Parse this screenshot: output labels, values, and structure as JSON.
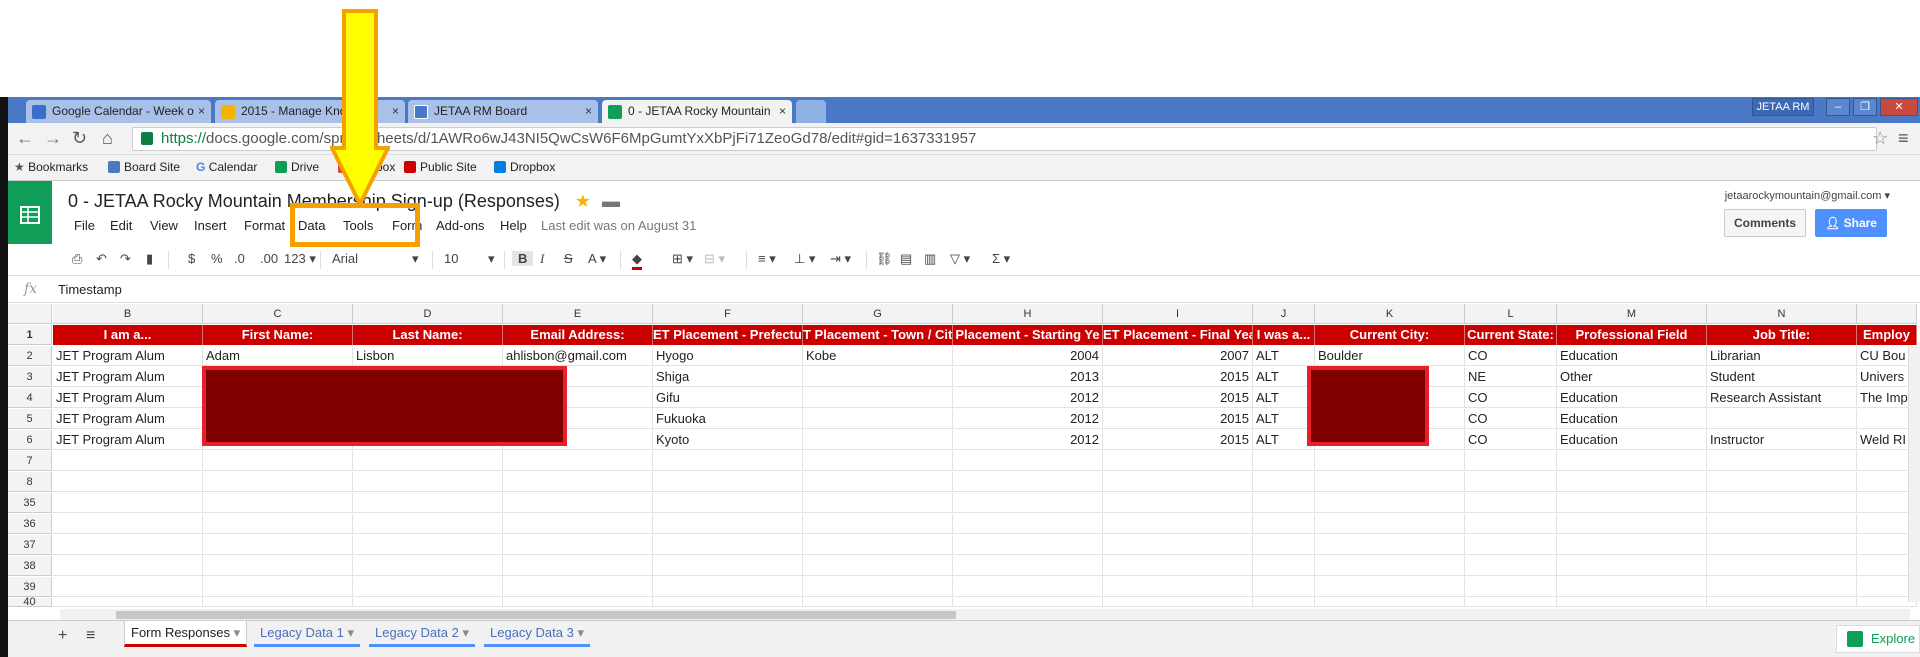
{
  "browser": {
    "tabs": [
      {
        "title": "Google Calendar - Week o",
        "icon_color": "#3b6fc7"
      },
      {
        "title": "2015 - Manage Kno",
        "icon_color": "#f4b400"
      },
      {
        "title": "JETAA RM Board",
        "icon_color": "#4a78c4"
      },
      {
        "title": "0 - JETAA Rocky Mountain",
        "icon_color": "#0f9d58"
      }
    ],
    "tab_close": "×",
    "profile_label": "JETAA RM",
    "window_buttons": [
      "–",
      "❐",
      "✕"
    ],
    "url_scheme": "https://",
    "url_rest": "docs.google.com/spreadsheets/d/1AWRo6wJ43NI5QwCsW6F6MpGumtYxXbPjFi71ZeoGd78/edit#gid=1637331957",
    "bookmarks": [
      {
        "label": "Bookmarks",
        "icon": "star-icon",
        "color": "#555555"
      },
      {
        "label": "Board Site",
        "icon": "board-icon",
        "color": "#4a78c4"
      },
      {
        "label": "Calendar",
        "icon": "google-icon",
        "color": "#4285f4"
      },
      {
        "label": "Drive",
        "icon": "drive-icon",
        "color": "#0f9d58"
      },
      {
        "label": "Mailbox",
        "icon": "mail-icon",
        "color": "#db4437"
      },
      {
        "label": "Public Site",
        "icon": "site-icon",
        "color": "#cc0000"
      },
      {
        "label": "Dropbox",
        "icon": "dropbox-icon",
        "color": "#007ee5"
      }
    ]
  },
  "sheets": {
    "doc_title": "0 - JETAA Rocky Mountain Membership Sign-up (Responses)",
    "menu": [
      "File",
      "Edit",
      "View",
      "Insert",
      "Format",
      "Data",
      "Tools",
      "Form",
      "Add-ons",
      "Help"
    ],
    "last_edit": "Last edit was on August 31",
    "account": "jetaarockymountain@gmail.com",
    "comments_label": "Comments",
    "share_label": "Share",
    "toolbar": {
      "currency": "$",
      "percent": "%",
      "dec_less": ".0",
      "dec_more": ".00",
      "more_formats": "123",
      "font": "Arial",
      "size": "10",
      "bold": "B",
      "italic": "I",
      "strike": "S",
      "text_color": "A",
      "sigma": "Σ"
    },
    "formula_label": "fx",
    "formula_value": "Timestamp",
    "columns": [
      "B",
      "C",
      "D",
      "E",
      "F",
      "G",
      "H",
      "I",
      "J",
      "K",
      "L",
      "M",
      "N"
    ],
    "header_row": [
      "I am a...",
      "First Name:",
      "Last Name:",
      "Email Address:",
      "ET Placement - Prefectur",
      "T Placement - Town / Cit",
      "Placement - Starting Ye",
      "ET Placement - Final Yea",
      "I was a...",
      "Current City:",
      "Current State:",
      "Professional Field",
      "Job Title:",
      "Employ"
    ],
    "rows": [
      [
        "JET Program Alum",
        "Adam",
        "Lisbon",
        "ahlisbon@gmail.com",
        "Hyogo",
        "Kobe",
        "2004",
        "2007",
        "ALT",
        "Boulder",
        "CO",
        "Education",
        "Librarian",
        "CU Bou"
      ],
      [
        "JET Program Alum",
        "",
        "",
        "",
        "Shiga",
        "",
        "2013",
        "2015",
        "ALT",
        "",
        "NE",
        "Other",
        "Student",
        "Univers"
      ],
      [
        "JET Program Alum",
        "",
        "",
        "",
        "Gifu",
        "",
        "2012",
        "2015",
        "ALT",
        "",
        "CO",
        "Education",
        "Research Assistant",
        "The Imp"
      ],
      [
        "JET Program Alum",
        "",
        "",
        "",
        "Fukuoka",
        "",
        "2012",
        "2015",
        "ALT",
        "",
        "CO",
        "Education",
        "",
        ""
      ],
      [
        "JET Program Alum",
        "",
        "",
        "",
        "Kyoto",
        "",
        "2012",
        "2015",
        "ALT",
        "",
        "CO",
        "Education",
        "Instructor",
        "Weld RI"
      ]
    ],
    "row_numbers": [
      "1",
      "2",
      "3",
      "4",
      "5",
      "6",
      "7",
      "8",
      "35",
      "36",
      "37",
      "38",
      "39",
      "40"
    ],
    "sheet_tabs": [
      "Form Responses",
      "Legacy Data 1",
      "Legacy Data 2",
      "Legacy Data 3"
    ],
    "add_sheet": "+",
    "all_sheets": "≡",
    "explore_label": "Explore"
  },
  "colors": {
    "header_red": "#cc0000",
    "redaction": "#800000",
    "highlight_orange": "#f5a000",
    "arrow_yellow": "#ffff00",
    "sheets_green": "#0f9d58"
  }
}
